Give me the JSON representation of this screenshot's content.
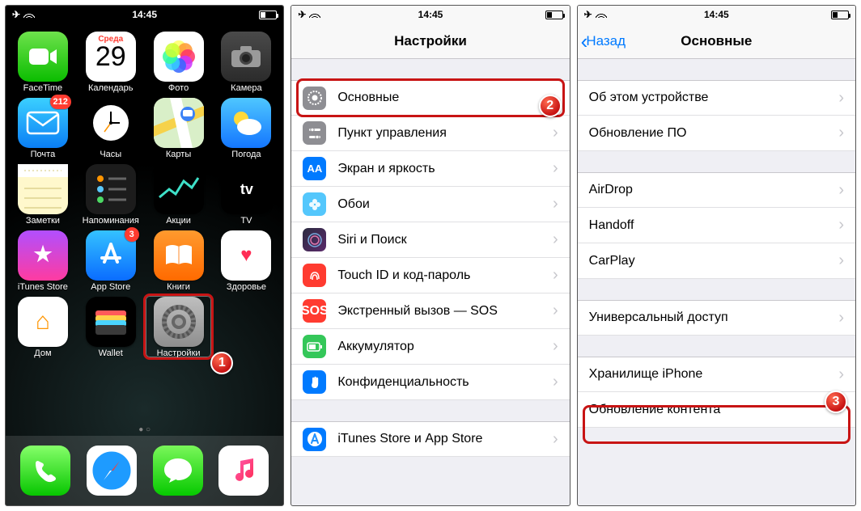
{
  "statusbar": {
    "time": "14:45"
  },
  "home": {
    "apps": [
      {
        "label": "FaceTime",
        "name": "facetime"
      },
      {
        "label": "Календарь",
        "name": "calendar",
        "weekday": "Среда",
        "day": "29"
      },
      {
        "label": "Фото",
        "name": "photos"
      },
      {
        "label": "Камера",
        "name": "camera"
      },
      {
        "label": "Почта",
        "name": "mail",
        "badge": "212"
      },
      {
        "label": "Часы",
        "name": "clock"
      },
      {
        "label": "Карты",
        "name": "maps"
      },
      {
        "label": "Погода",
        "name": "weather"
      },
      {
        "label": "Заметки",
        "name": "notes"
      },
      {
        "label": "Напоминания",
        "name": "reminders"
      },
      {
        "label": "Акции",
        "name": "stocks"
      },
      {
        "label": "TV",
        "name": "tv"
      },
      {
        "label": "iTunes Store",
        "name": "itunes"
      },
      {
        "label": "App Store",
        "name": "appstore",
        "badge": "3"
      },
      {
        "label": "Книги",
        "name": "books"
      },
      {
        "label": "Здоровье",
        "name": "health"
      },
      {
        "label": "Дом",
        "name": "homekit"
      },
      {
        "label": "Wallet",
        "name": "wallet"
      },
      {
        "label": "Настройки",
        "name": "settings"
      }
    ],
    "dock": [
      "phone",
      "safari",
      "messages",
      "music"
    ]
  },
  "settings_root": {
    "title": "Настройки",
    "groups": [
      [
        {
          "label": "Основные",
          "icon": "gear",
          "style": "li-gray"
        },
        {
          "label": "Пункт управления",
          "icon": "switches",
          "style": "li-gray"
        },
        {
          "label": "Экран и яркость",
          "icon": "AA",
          "style": "li-blue"
        },
        {
          "label": "Обои",
          "icon": "flower",
          "style": "li-cyan"
        },
        {
          "label": "Siri и Поиск",
          "icon": "siri",
          "style": "li-siri"
        },
        {
          "label": "Touch ID и код-пароль",
          "icon": "finger",
          "style": "li-red"
        },
        {
          "label": "Экстренный вызов — SOS",
          "icon": "SOS",
          "style": "li-sos"
        },
        {
          "label": "Аккумулятор",
          "icon": "batt",
          "style": "li-green"
        },
        {
          "label": "Конфиденциальность",
          "icon": "hand",
          "style": "li-hand"
        }
      ],
      [
        {
          "label": "iTunes Store и App Store",
          "icon": "A",
          "style": "li-blue"
        }
      ]
    ]
  },
  "general": {
    "back": "Назад",
    "title": "Основные",
    "groups": [
      [
        {
          "label": "Об этом устройстве"
        },
        {
          "label": "Обновление ПО"
        }
      ],
      [
        {
          "label": "AirDrop"
        },
        {
          "label": "Handoff"
        },
        {
          "label": "CarPlay"
        }
      ],
      [
        {
          "label": "Универсальный доступ"
        }
      ],
      [
        {
          "label": "Хранилище iPhone"
        },
        {
          "label": "Обновление контента"
        }
      ]
    ]
  },
  "callouts": {
    "one": "1",
    "two": "2",
    "three": "3"
  }
}
